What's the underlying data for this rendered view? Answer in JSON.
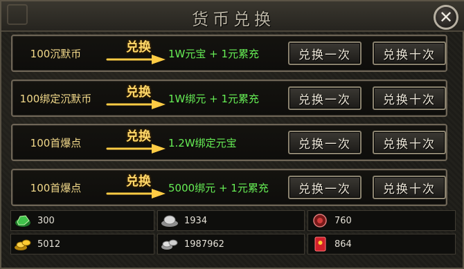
{
  "window": {
    "title": "货币兑换"
  },
  "exchange_label": "兑换",
  "rows": [
    {
      "from": "100沉默币",
      "to": "1W元宝 + 1元累充",
      "btn_once": "兑换一次",
      "btn_ten": "兑换十次"
    },
    {
      "from": "100绑定沉默币",
      "to": "1W绑元 +  1元累充",
      "btn_once": "兑换一次",
      "btn_ten": "兑换十次"
    },
    {
      "from": "100首爆点",
      "to": "1.2W绑定元宝",
      "btn_once": "兑换一次",
      "btn_ten": "兑换十次"
    },
    {
      "from": "100首爆点",
      "to": "5000绑元 + 1元累充",
      "btn_once": "兑换一次",
      "btn_ten": "兑换十次"
    }
  ],
  "resources": [
    {
      "icon": "green-gem-icon",
      "value": "300"
    },
    {
      "icon": "silver-ingot-icon",
      "value": "1934"
    },
    {
      "icon": "red-orb-icon",
      "value": "760"
    },
    {
      "icon": "gold-ingot-icon",
      "value": "5012"
    },
    {
      "icon": "silver-bars-icon",
      "value": "1987962"
    },
    {
      "icon": "red-envelope-icon",
      "value": "864"
    }
  ],
  "colors": {
    "gold_text": "#f2d98a",
    "green_text": "#66ee55",
    "button_text": "#ece6d8"
  }
}
